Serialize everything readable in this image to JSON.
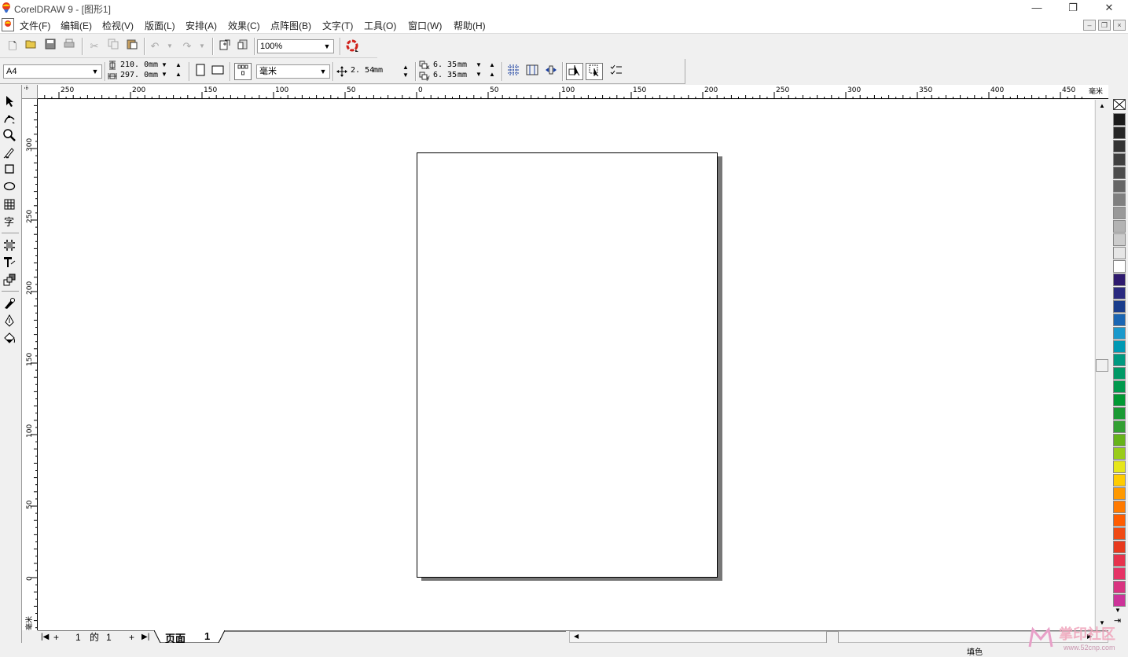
{
  "window": {
    "title": "CorelDRAW 9 - [图形1]",
    "minimize": "—",
    "restore": "❐",
    "close": "✕"
  },
  "menubar": {
    "items": [
      "文件(F)",
      "编辑(E)",
      "检视(V)",
      "版面(L)",
      "安排(A)",
      "效果(C)",
      "点阵图(B)",
      "文字(T)",
      "工具(O)",
      "窗口(W)",
      "帮助(H)"
    ],
    "mdi_min": "–",
    "mdi_restore": "❐",
    "mdi_close": "×"
  },
  "standard_toolbar": {
    "zoom_value": "100%"
  },
  "property_bar": {
    "paper_size": "A4",
    "width_value": "210. 0",
    "height_value": "297. 0",
    "width_unit": "mm",
    "height_unit": "mm",
    "units": "毫米",
    "nudge_value": "2. 54",
    "nudge_unit": "mm",
    "dup_x_label": "x",
    "dup_y_label": "y",
    "dup_x_value": "6. 35",
    "dup_y_value": "6. 35",
    "dup_x_unit": "mm",
    "dup_y_unit": "mm"
  },
  "rulers": {
    "h_labels": [
      "250",
      "200",
      "150",
      "100",
      "50",
      "0",
      "50",
      "100",
      "150",
      "200",
      "250",
      "300",
      "350",
      "400",
      "450"
    ],
    "h_unit": "毫米",
    "v_labels": [
      "300",
      "250",
      "200",
      "150",
      "100",
      "50",
      "0"
    ],
    "v_unit": "毫米"
  },
  "page_nav": {
    "current": "1",
    "of": "的",
    "total": "1",
    "tab_label": "页面",
    "tab_number": "1"
  },
  "status": {
    "text": "填色"
  },
  "watermark": {
    "text": "掌印社区",
    "url": "www.52cnp.com"
  },
  "palette": {
    "colors": [
      "#1a1a1a",
      "#262626",
      "#333333",
      "#404040",
      "#4d4d4d",
      "#666666",
      "#808080",
      "#999999",
      "#b3b3b3",
      "#cccccc",
      "#e6e6e6",
      "#ffffff",
      "#2e1a6e",
      "#2a2a80",
      "#1a3d8c",
      "#1a66b3",
      "#1a99cc",
      "#0099b3",
      "#009980",
      "#009966",
      "#00994d",
      "#009933",
      "#1a9933",
      "#33a033",
      "#66b31a",
      "#99cc1a",
      "#e6e61a",
      "#ffcc00",
      "#ff9900",
      "#ff7a00",
      "#ff5c00",
      "#f04a14",
      "#e83a1e",
      "#e6334d",
      "#e63366",
      "#d93380",
      "#cc3399"
    ]
  }
}
